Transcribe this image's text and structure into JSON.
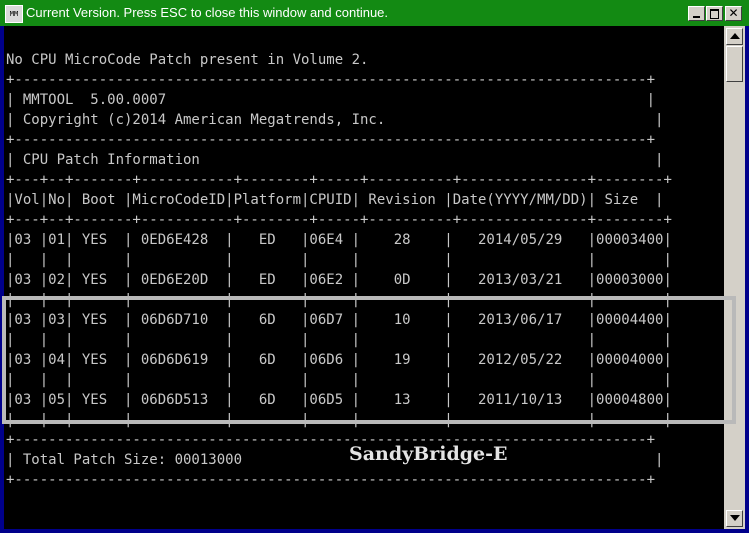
{
  "window": {
    "title": "Current Version. Press ESC to close this window and continue.",
    "icon": "command-prompt-icon",
    "icon_text": "MM"
  },
  "console": {
    "lines": [
      "No CPU MicroCode Patch present in Volume 2.",
      "+---------------------------------------------------------------------------+",
      "| MMTOOL  5.00.0007                                                         |",
      "| Copyright (c)2014 American Megatrends, Inc.                                |",
      "+---------------------------------------------------------------------------+",
      "| CPU Patch Information                                                      |",
      "+---+--+-------+-----------+--------+-----+----------+---------------+--------+",
      "|Vol|No| Boot |MicroCodeID|Platform|CPUID| Revision |Date(YYYY/MM/DD)| Size  |",
      "+---+--+-------+-----------+--------+-----+----------+---------------+--------+",
      "|03 |01| YES  | 0ED6E428  |   ED   |06E4 |    28    |   2014/05/29   |00003400|",
      "|   |  |      |           |        |     |          |                |        |",
      "|03 |02| YES  | 0ED6E20D  |   ED   |06E2 |    0D    |   2013/03/21   |00003000|",
      "|   |  |      |           |        |     |          |                |        |",
      "|03 |03| YES  | 06D6D710  |   6D   |06D7 |    10    |   2013/06/17   |00004400|",
      "|   |  |      |           |        |     |          |                |        |",
      "|03 |04| YES  | 06D6D619  |   6D   |06D6 |    19    |   2012/05/22   |00004000|",
      "|   |  |      |           |        |     |          |                |        |",
      "|03 |05| YES  | 06D6D513  |   6D   |06D5 |    13    |   2011/10/13   |00004800|",
      "|   |  |      |           |        |     |          |                |        |",
      "+---------------------------------------------------------------------------+",
      "| Total Patch Size: 00013000                                                 |",
      "+---------------------------------------------------------------------------+"
    ]
  },
  "annotation": {
    "label": "SandyBridge-E"
  },
  "colors": {
    "title_bar": "#138a13",
    "console_bg": "#000000",
    "console_text": "#c8c8c8",
    "highlight_border": "#b9b9b9"
  },
  "controls": {
    "minimize_icon": "minimize-icon",
    "maximize_icon": "maximize-icon",
    "close_icon": "close-icon",
    "close_glyph": "✕"
  }
}
